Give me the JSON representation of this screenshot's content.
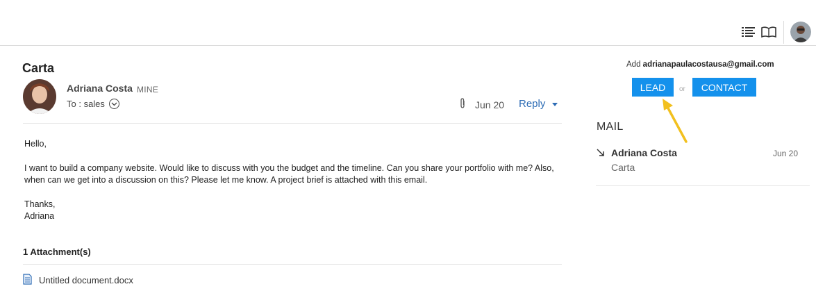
{
  "topbar": {
    "icons": [
      "list-view-icon",
      "book-icon"
    ],
    "user_avatar": "user-avatar"
  },
  "email": {
    "subject": "Carta",
    "sender_name": "Adriana Costa",
    "sender_tag": "MINE",
    "to_line": "To : sales",
    "date": "Jun 20",
    "reply_label": "Reply",
    "body": {
      "greeting": "Hello,",
      "paragraph": "I want to build a company website. Would like to discuss with you the budget and the timeline. Can you share your portfolio with me? Also, when can we get into a discussion on this? Please let me know. A project brief is attached with this email.",
      "signoff": "Thanks,",
      "signature": "Adriana"
    },
    "attachments_title": "1 Attachment(s)",
    "attachments": [
      {
        "name": "Untitled document.docx",
        "icon": "document-icon"
      }
    ]
  },
  "right_panel": {
    "add_prefix": "Add",
    "add_email": "adrianapaulacostausa@gmail.com",
    "lead_label": "LEAD",
    "or_label": "or",
    "contact_label": "CONTACT",
    "mail_heading": "MAIL",
    "mail_items": [
      {
        "name": "Adriana Costa",
        "date": "Jun 20",
        "subject": "Carta",
        "direction_icon": "incoming-arrow-icon"
      }
    ]
  },
  "colors": {
    "button_blue": "#1491ec",
    "link_blue": "#2d6cb5",
    "annotation_arrow": "#f2c01e"
  }
}
